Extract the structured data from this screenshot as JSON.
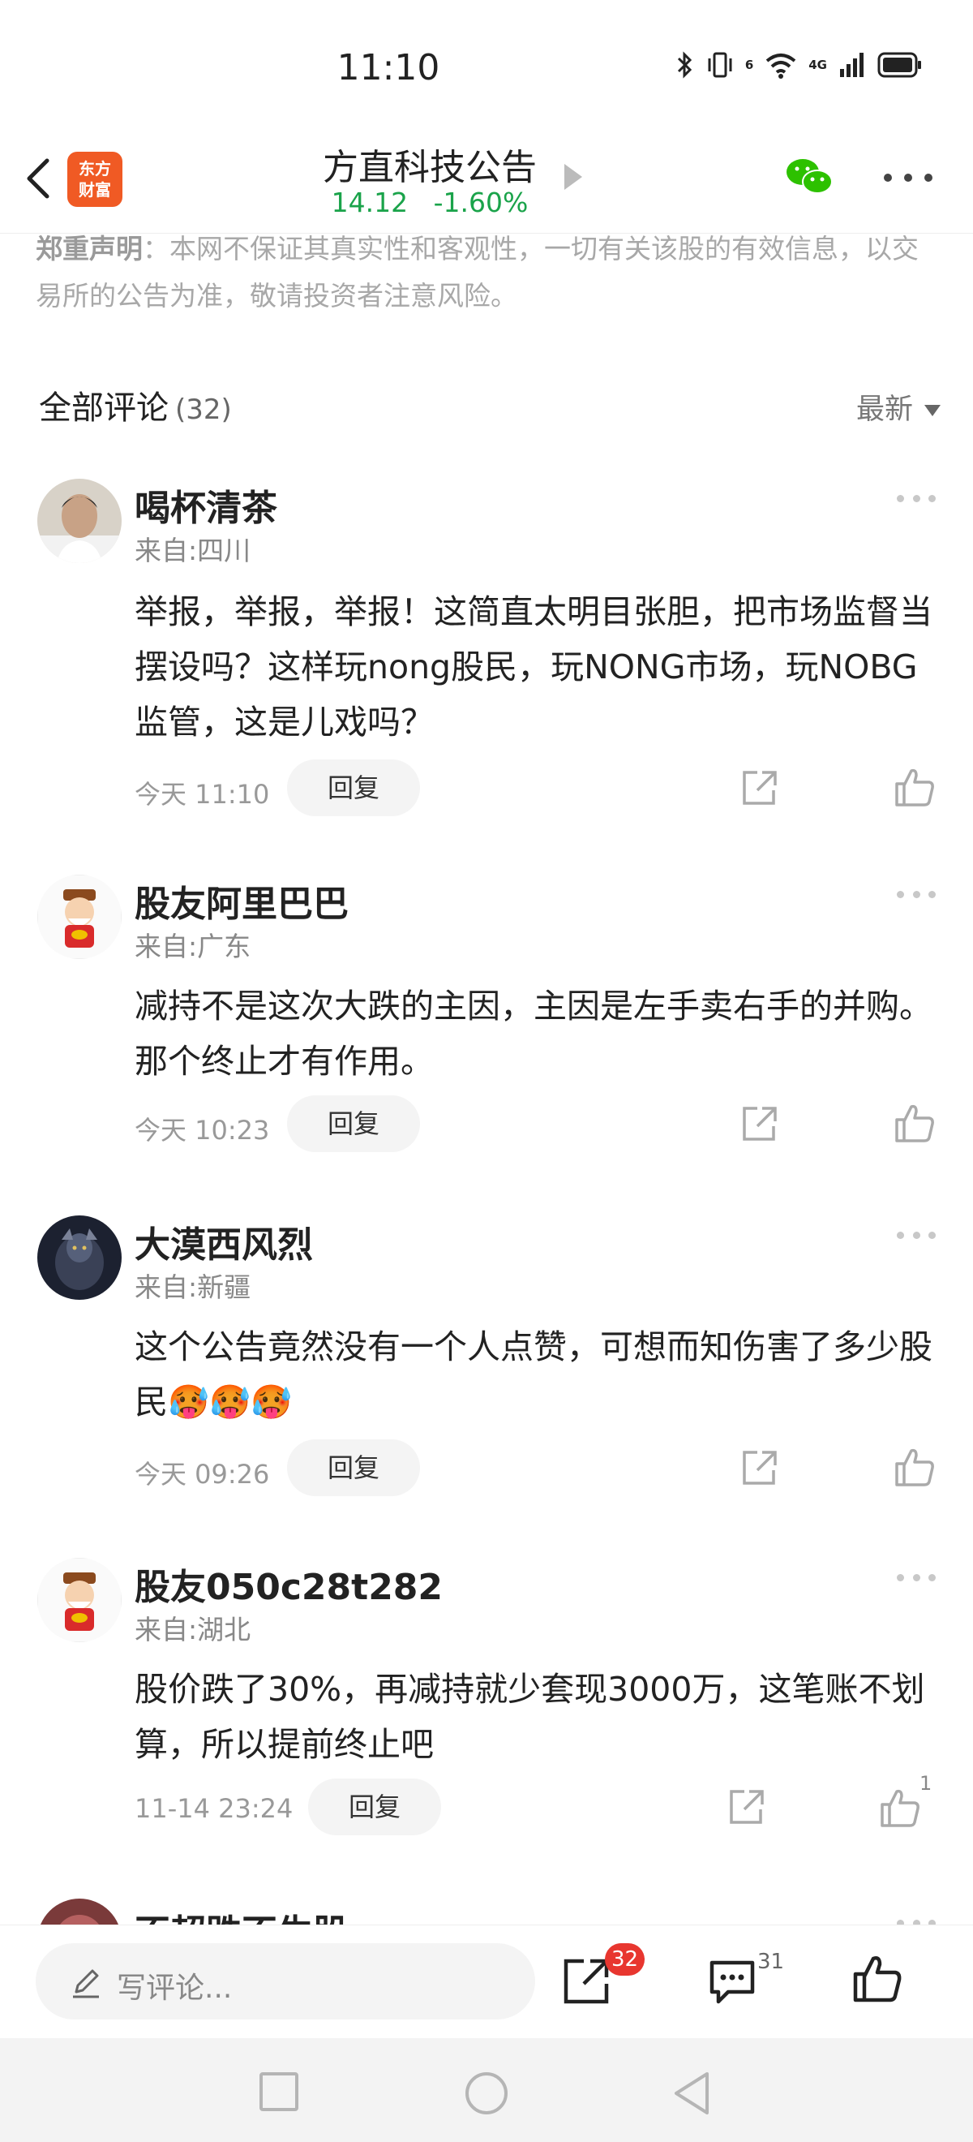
{
  "status_bar": {
    "time": "11:10",
    "signal_label_a": "6",
    "signal_label_b": "4G",
    "icons": [
      "bluetooth-icon",
      "vibrate-icon",
      "wifi-icon",
      "cellular-signal-icon",
      "battery-icon"
    ]
  },
  "nav": {
    "back_icon": "chevron-left-icon",
    "logo_line1": "东方",
    "logo_line2": "财富",
    "title": "方直科技公告",
    "price": "14.12",
    "change": "-1.60%",
    "quote_color": "#1aa34a",
    "wechat_icon": "wechat-icon",
    "more_icon": "more-dots-icon"
  },
  "disclaimer": {
    "label": "郑重声明",
    "text": "：本网不保证其真实性和客观性，一切有关该股的有效信息，以交易所的公告为准，敬请投资者注意风险。"
  },
  "comments_header": {
    "title": "全部评论",
    "count": "(32)",
    "sort_label": "最新"
  },
  "comments": [
    {
      "username": "喝杯清茶",
      "location": "来自:四川",
      "text": "举报，举报，举报！这简直太明目张胆，把市场监督当摆设吗？这样玩nong股民，玩NONG市场，玩NOBG监管，这是儿戏吗？",
      "time": "今天 11:10",
      "reply_label": "回复",
      "likes": ""
    },
    {
      "username": "股友阿里巴巴",
      "location": "来自:广东",
      "text": "减持不是这次大跌的主因，主因是左手卖右手的并购。那个终止才有作用。",
      "time": "今天 10:23",
      "reply_label": "回复",
      "likes": ""
    },
    {
      "username": "大漠西风烈",
      "location": "来自:新疆",
      "text": "这个公告竟然没有一个人点赞，可想而知伤害了多少股民",
      "emoji": "🥵🥵🥵",
      "time": "今天 09:26",
      "reply_label": "回复",
      "likes": ""
    },
    {
      "username": "股友050c28t282",
      "location": "来自:湖北",
      "text": "股价跌了30%，再减持就少套现3000万，这笔账不划算，所以提前终止吧",
      "time": "11-14 23:24",
      "reply_label": "回复",
      "likes": "1"
    },
    {
      "username": "不超跌不生股",
      "location": "",
      "text": "",
      "time": "",
      "reply_label": "",
      "likes": ""
    }
  ],
  "bottom_bar": {
    "compose_placeholder": "写评论...",
    "share_badge": "32",
    "comment_count": "31",
    "accent": "#e8362f"
  }
}
